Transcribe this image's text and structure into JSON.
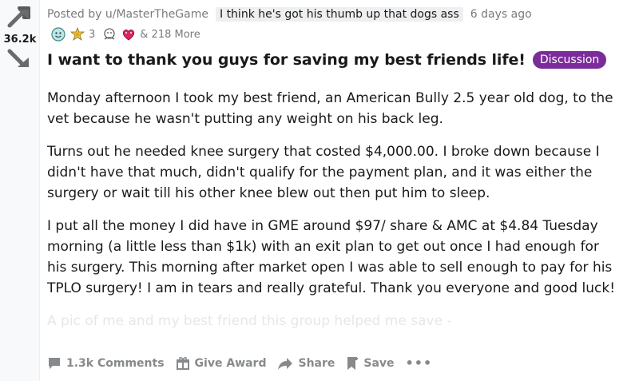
{
  "vote": {
    "score": "36.2k"
  },
  "post": {
    "author_prefix": "Posted by u/MasterTheGame",
    "user_flair": "I think he's got his thumb up that dogs ass",
    "time": "6 days ago",
    "award_count": "3",
    "more_awards": "& 218 More",
    "title": "I want to thank you guys for saving my best friends life!",
    "post_flair": "Discussion",
    "paragraphs": [
      "Monday afternoon I took my best friend, an American Bully 2.5 year old dog, to the vet because he wasn't putting any weight on his back leg.",
      "Turns out he needed knee surgery that costed $4,000.00. I broke down because I didn't have that much, didn't qualify for the payment plan, and it was either the surgery or wait till his other knee blew out then put him to sleep.",
      "I put all the money I did have in GME around $97/ share & AMC at $4.84 Tuesday morning (a little less than $1k) with an exit plan to get out once I had enough for his surgery. This morning after market open I was able to sell enough to pay for his TPLO surgery! I am in tears and really grateful. Thank you everyone and good luck!",
      "A pic of me and my best friend this group helped me save -"
    ]
  },
  "actions": {
    "comments": "1.3k Comments",
    "give_award": "Give Award",
    "share": "Share",
    "save": "Save",
    "more": "•••"
  },
  "colors": {
    "post_flair_bg": "#7b2b9a",
    "meta_text": "#787c7e",
    "action_text": "#878a8c"
  }
}
